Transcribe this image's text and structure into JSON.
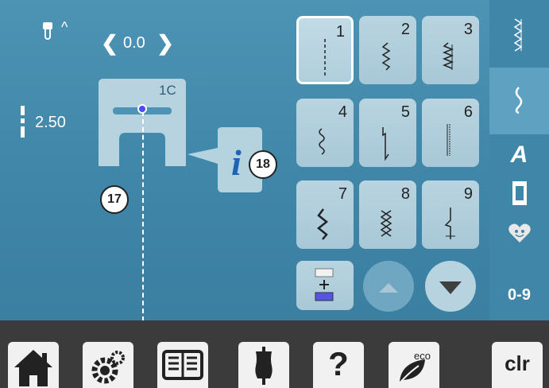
{
  "header": {
    "needle_position_value": "0.0",
    "stitch_length_value": "2.50"
  },
  "presser_foot": {
    "label": "1C"
  },
  "callouts": {
    "foot_callout": "17",
    "info_callout": "18"
  },
  "stitches": [
    {
      "number": "1",
      "pattern": "straight",
      "selected": true
    },
    {
      "number": "2",
      "pattern": "zigzag-narrow",
      "selected": false
    },
    {
      "number": "3",
      "pattern": "vari-overlock",
      "selected": false
    },
    {
      "number": "4",
      "pattern": "serpentine",
      "selected": false
    },
    {
      "number": "5",
      "pattern": "securing-stitch",
      "selected": false
    },
    {
      "number": "6",
      "pattern": "triple-straight",
      "selected": false
    },
    {
      "number": "7",
      "pattern": "triple-zigzag",
      "selected": false
    },
    {
      "number": "8",
      "pattern": "honeycomb",
      "selected": false
    },
    {
      "number": "9",
      "pattern": "blind-stitch",
      "selected": false
    }
  ],
  "right_menu": {
    "alphabet_label": "A",
    "direct_entry_label": "0-9"
  },
  "bottom_bar": {
    "eco_label": "eco",
    "help_label": "?",
    "clear_label": "clr"
  },
  "colors": {
    "background": "#4a90b2",
    "stitch_tile": "#b2cfdc",
    "bottom_bar": "#3b3b3b",
    "needle_dot": "#4a4df0"
  }
}
